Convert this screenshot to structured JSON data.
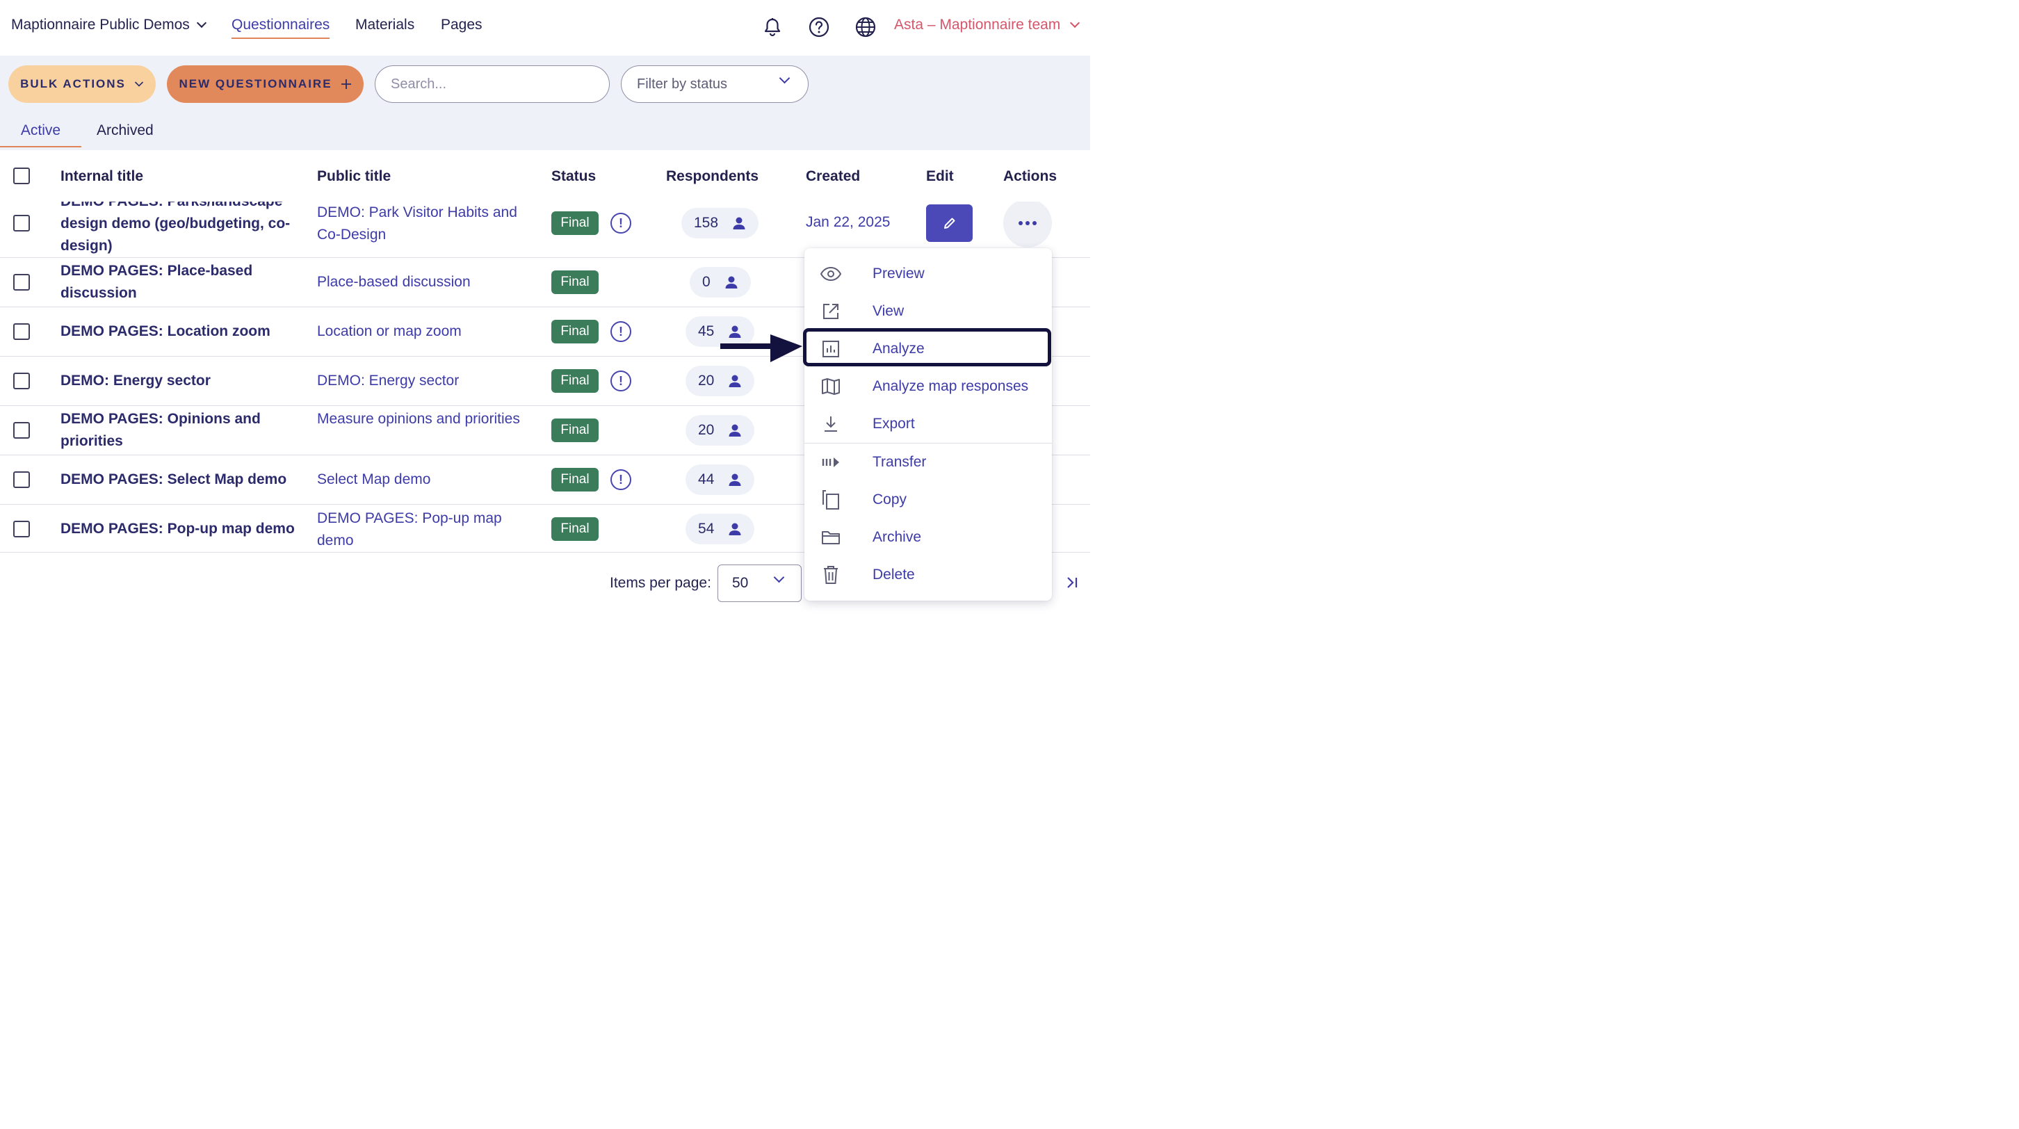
{
  "header": {
    "org": "Maptionnaire Public Demos",
    "nav": [
      "Questionnaires",
      "Materials",
      "Pages"
    ],
    "user": "Asta – Maptionnaire team"
  },
  "toolbar": {
    "bulk_label": "BULK ACTIONS",
    "new_label": "NEW QUESTIONNAIRE",
    "search_placeholder": "Search...",
    "filter_label": "Filter by status"
  },
  "tabs": [
    "Active",
    "Archived"
  ],
  "columns": [
    "Internal title",
    "Public title",
    "Status",
    "Respondents",
    "Created",
    "Edit",
    "Actions"
  ],
  "rows": [
    {
      "internal": "DEMO PAGES: Parks/landscape design demo (geo/budgeting, co-design)",
      "public": "DEMO: Park Visitor Habits and Co-Design",
      "status": "Final",
      "warn": true,
      "respondents": "158",
      "created": "Jan 22, 2025"
    },
    {
      "internal": "DEMO PAGES: Place-based discussion",
      "public": "Place-based discussion",
      "status": "Final",
      "warn": false,
      "respondents": "0"
    },
    {
      "internal": "DEMO PAGES: Location zoom",
      "public": "Location or map zoom",
      "status": "Final",
      "warn": true,
      "respondents": "45"
    },
    {
      "internal": "DEMO: Energy sector",
      "public": "DEMO: Energy sector",
      "status": "Final",
      "warn": true,
      "respondents": "20"
    },
    {
      "internal": "DEMO PAGES: Opinions and priorities",
      "public": "Measure opinions and priorities",
      "status": "Final",
      "warn": false,
      "respondents": "20"
    },
    {
      "internal": "DEMO PAGES: Select Map demo",
      "public": "Select Map demo",
      "status": "Final",
      "warn": true,
      "respondents": "44"
    },
    {
      "internal": "DEMO PAGES: Pop-up map demo",
      "public": "DEMO PAGES: Pop-up map demo",
      "status": "Final",
      "warn": false,
      "respondents": "54"
    }
  ],
  "warn_symbol": "!",
  "actions_menu": {
    "items": [
      "Preview",
      "View",
      "Analyze",
      "Analyze map responses",
      "Export",
      "Transfer",
      "Copy",
      "Archive",
      "Delete"
    ],
    "icons": [
      "eye-icon",
      "external-link-icon",
      "chart-icon",
      "map-icon",
      "download-icon",
      "transfer-icon",
      "copy-icon",
      "folder-icon",
      "trash-icon"
    ],
    "highlighted": "Analyze"
  },
  "footer": {
    "items_per_page_label": "Items per page:",
    "items_per_page_value": "50"
  },
  "colors": {
    "accent": "#3d3ba8",
    "badge": "#3b7c5a",
    "new_button": "#e2895b",
    "bulk_button": "#f8d19f",
    "user": "#d5566a"
  }
}
